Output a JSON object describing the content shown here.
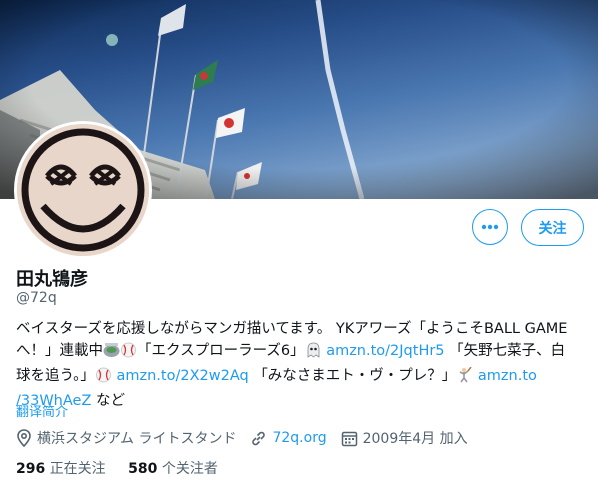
{
  "profile": {
    "name": "田丸鴇彦",
    "handle": "@72q",
    "bio": {
      "l1": "ベイスターズを応援しながらマンガ描いてます。 YKアワーズ「ようこそBALL GAME",
      "l2a": "へ！」連載中",
      "l2b": "「エクスプローラーズ6」",
      "l2link": "amzn.to/2JqtHr5",
      "l2c": "「矢野七菜子、白",
      "l3a": "球を追う。」",
      "l3link": "amzn.to/2X2w2Aq",
      "l3b": "「みなさまエト・ヴ・プレ？」",
      "l3link2": "amzn.to",
      "l4link": "/33WhAeZ",
      "l4b": "など"
    },
    "translate": "翻译简介",
    "location": "横浜スタジアム ライトスタンド",
    "website": "72q.org",
    "joined": "2009年4月 加入",
    "following_count": "296",
    "following_label": "正在关注",
    "followers_count": "580",
    "followers_label": "个关注者"
  },
  "actions": {
    "follow_label": "关注"
  },
  "icons": [
    "more-icon",
    "location-icon",
    "link-icon",
    "calendar-icon",
    "stadium-emoji",
    "baseball-emoji",
    "ghost-emoji",
    "batter-emoji"
  ],
  "colors": {
    "accent": "#1d9bf0",
    "secondary_text": "#536471",
    "primary_text": "#0f1419"
  }
}
